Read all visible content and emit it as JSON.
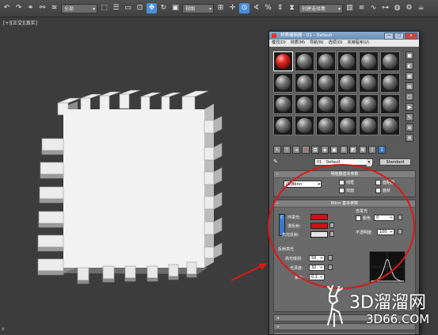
{
  "toolbar": {
    "selection_filter": "全部",
    "view_dropdown": "视图",
    "named_selection": "创建选择集",
    "buttons": [
      "undo-icon",
      "redo-icon",
      "link-icon",
      "unlink-icon",
      "bind-icon",
      "select-icon",
      "select-name-icon",
      "rect-region-icon",
      "window-crossing-icon",
      "move-icon",
      "rotate-icon",
      "scale-icon",
      "pivot-icon",
      "select-manipulate-icon",
      "snap-icon",
      "angle-snap-icon",
      "percent-snap-icon",
      "spinner-snap-icon",
      "mirror-icon",
      "align-icon",
      "layer-icon",
      "curve-editor-icon",
      "schematic-icon",
      "material-editor-icon",
      "render-setup-icon",
      "render-frame-icon",
      "render-icon"
    ]
  },
  "viewport": {
    "label": "[+][正交][真实]",
    "axis_label": "x"
  },
  "material_editor": {
    "title": "材质编辑器 - 01 - Default",
    "window_buttons": [
      "—",
      "□",
      "x"
    ],
    "menu": [
      "模式(D)",
      "材质(M)",
      "导航(N)",
      "选项(O)",
      "实用程序(U)"
    ],
    "material_name": "01 - Default",
    "type_button": "Standard",
    "shader_rollout": {
      "title": "明暗器基本参数",
      "shader": "(B)Blinn",
      "options": [
        "线框",
        "双面",
        "面贴图",
        "面状"
      ]
    },
    "blinn_rollout": {
      "title": "Blinn 基本参数",
      "self_illum_title": "自发光",
      "color_label": "颜色",
      "color_value": "0",
      "ambient_label": "环境光:",
      "diffuse_label": "漫反射:",
      "specular_label": "高光反射:",
      "opacity_label": "不透明度:",
      "opacity_value": "100",
      "lock_label": "C",
      "ambient_color": "#c81414",
      "diffuse_color": "#c81414",
      "specular_color": "#e6e6e6"
    },
    "highlights": {
      "title": "反射高光",
      "specular_level_label": "高光级别:",
      "specular_level": "59",
      "glossiness_label": "光泽度:",
      "glossiness": "32",
      "soften_label": "柔化:",
      "soften": "0.1"
    }
  },
  "watermark": {
    "brand": "3D溜溜网",
    "url": "3D66.COM"
  },
  "annotation_colors": {
    "circle": "#d81818",
    "arrow": "#d81818"
  }
}
